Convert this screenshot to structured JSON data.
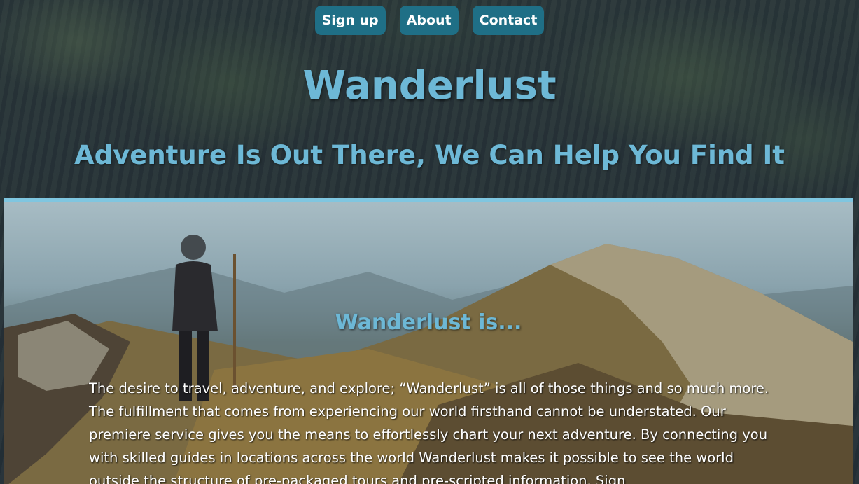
{
  "nav": {
    "items": [
      {
        "label": "Sign up"
      },
      {
        "label": "About"
      },
      {
        "label": "Contact"
      }
    ]
  },
  "header": {
    "title": "Wanderlust",
    "tagline": "Adventure Is Out There, We Can Help You Find It"
  },
  "about": {
    "heading": "Wanderlust is...",
    "body": "The desire to travel, adventure, and explore; “Wanderlust” is all of those things and so much more. The fulfillment that comes from experiencing our world firsthand cannot be understated. Our premiere service gives you the means to effortlessly chart your next adventure. By connecting you with skilled guides in locations across the world Wanderlust makes it possible to see the world outside the structure of pre-packaged tours and pre-scripted information. Sign"
  },
  "colors": {
    "accent": "#6db8d6",
    "nav_bg": "#1f6f86",
    "divider": "#7fc6e0"
  }
}
